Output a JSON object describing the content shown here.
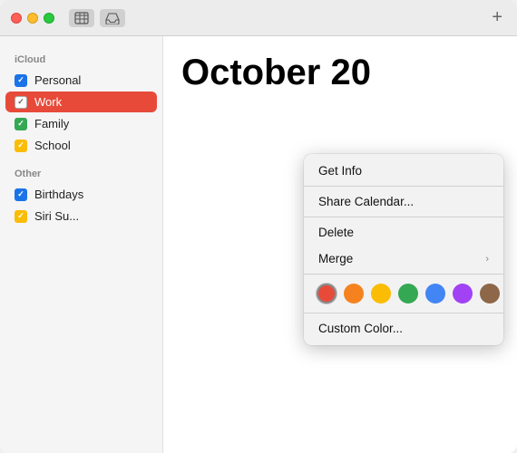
{
  "titlebar": {
    "traffic": {
      "close": "close",
      "minimize": "minimize",
      "maximize": "maximize"
    },
    "add_button": "+"
  },
  "sidebar": {
    "icloud_label": "iCloud",
    "other_label": "Other",
    "items": [
      {
        "name": "Personal",
        "checked": true,
        "color": "blue"
      },
      {
        "name": "Work",
        "checked": true,
        "color": "red",
        "selected": true
      },
      {
        "name": "Family",
        "checked": true,
        "color": "green"
      },
      {
        "name": "School",
        "checked": true,
        "color": "yellow"
      }
    ],
    "other_items": [
      {
        "name": "Birthdays",
        "checked": true,
        "color": "blue"
      },
      {
        "name": "Siri Su...",
        "checked": true,
        "color": "yellow"
      }
    ]
  },
  "calendar": {
    "title": "October 20"
  },
  "context_menu": {
    "items": [
      {
        "label": "Get Info",
        "has_submenu": false
      },
      {
        "label": "Share Calendar...",
        "has_submenu": false
      },
      {
        "label": "Delete",
        "has_submenu": false
      },
      {
        "label": "Merge",
        "has_submenu": true
      }
    ],
    "custom_color_label": "Custom Color...",
    "colors": [
      {
        "name": "red",
        "hex": "#e84a3a",
        "selected": true
      },
      {
        "name": "orange",
        "hex": "#f5821f",
        "selected": false
      },
      {
        "name": "yellow",
        "hex": "#fbbc04",
        "selected": false
      },
      {
        "name": "green",
        "hex": "#34a853",
        "selected": false
      },
      {
        "name": "blue",
        "hex": "#4285f4",
        "selected": false
      },
      {
        "name": "purple",
        "hex": "#a142f4",
        "selected": false
      },
      {
        "name": "brown",
        "hex": "#8d6748",
        "selected": false
      }
    ]
  }
}
